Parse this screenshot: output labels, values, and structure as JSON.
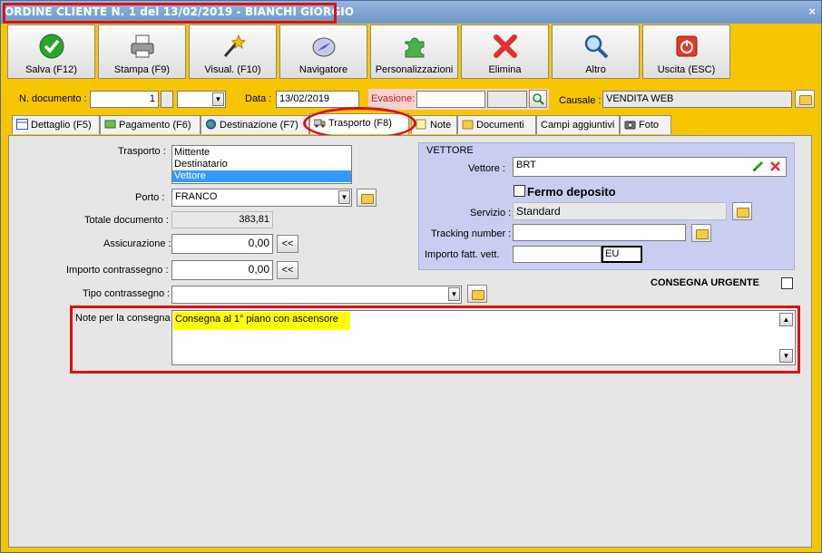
{
  "window": {
    "title": "ORDINE CLIENTE N. 1 del 13/02/2019 - BIANCHI GIORGIO",
    "close": "×"
  },
  "toolbar": [
    {
      "label": "Salva (F12)",
      "icon": "check-icon"
    },
    {
      "label": "Stampa (F9)",
      "icon": "printer-icon"
    },
    {
      "label": "Visual. (F10)",
      "icon": "magic-wand-icon"
    },
    {
      "label": "Navigatore",
      "icon": "compass-icon"
    },
    {
      "label": "Personalizzazioni",
      "icon": "puzzle-icon"
    },
    {
      "label": "Elimina",
      "icon": "delete-x-icon"
    },
    {
      "label": "Altro",
      "icon": "magnifier-icon"
    },
    {
      "label": "Uscita (ESC)",
      "icon": "power-icon"
    }
  ],
  "header": {
    "ndoc_label": "N. documento :",
    "ndoc_value": "1",
    "data_label": "Data :",
    "data_value": "13/02/2019",
    "evasione_label": "Evasione:",
    "causale_label": "Causale :",
    "causale_value": "VENDITA WEB"
  },
  "tabs": [
    {
      "label": "Dettaglio (F5)"
    },
    {
      "label": "Pagamento (F6)"
    },
    {
      "label": "Destinazione (F7)"
    },
    {
      "label": "Trasporto (F8)"
    },
    {
      "label": "Note"
    },
    {
      "label": "Documenti"
    },
    {
      "label": "Campi aggiuntivi"
    },
    {
      "label": "Foto"
    }
  ],
  "trasporto": {
    "trasporto_label": "Trasporto :",
    "trasporto_options": [
      "Mittente",
      "Destinatario",
      "Vettore"
    ],
    "porto_label": "Porto :",
    "porto_value": "FRANCO",
    "totale_label": "Totale documento :",
    "totale_value": "383,81",
    "assicurazione_label": "Assicurazione :",
    "assicurazione_value": "0,00",
    "contrassegno_label": "Importo contrassegno :",
    "contrassegno_value": "0,00",
    "copy_btn": "<<",
    "tipo_contrassegno_label": "Tipo contrassegno :",
    "note_label": "Note per la consegna",
    "note_value": "Consegna al 1° piano con ascensore",
    "consegna_urgente_label": "CONSEGNA URGENTE"
  },
  "vettore": {
    "group_title": "VETTORE",
    "vettore_label": "Vettore :",
    "vettore_value": "BRT",
    "fermo_label": "Fermo deposito",
    "servizio_label": "Servizio :",
    "servizio_value": "Standard",
    "tracking_label": "Tracking number :",
    "importo_label": "Importo fatt. vett.",
    "currency": "EU"
  }
}
